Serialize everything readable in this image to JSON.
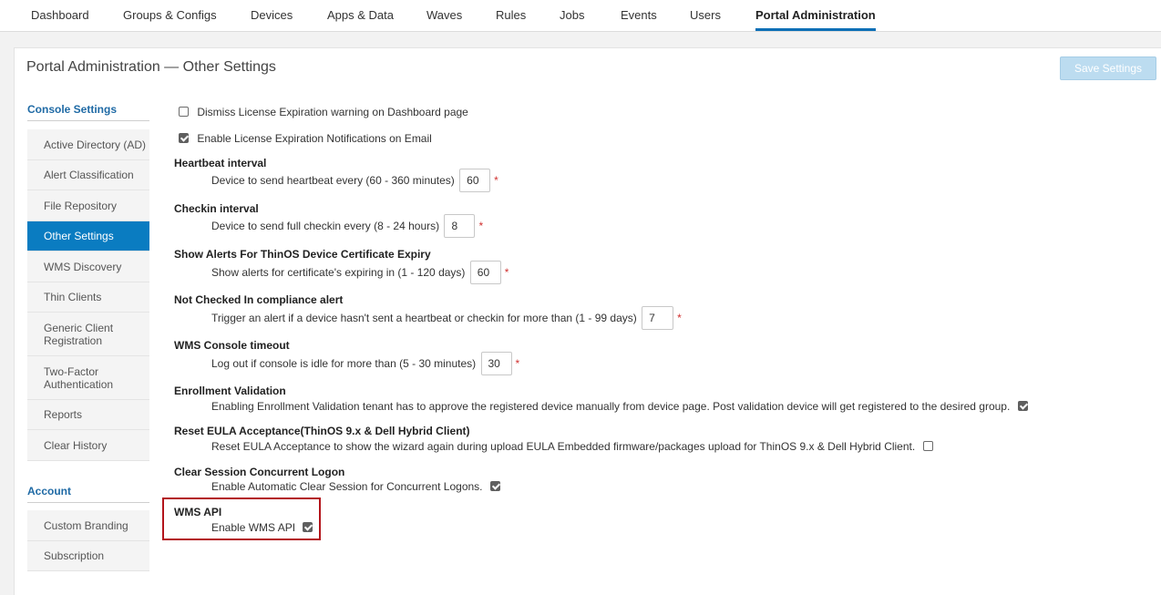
{
  "nav": {
    "items": [
      "Dashboard",
      "Groups & Configs",
      "Devices",
      "Apps & Data",
      "Waves",
      "Rules",
      "Jobs",
      "Events",
      "Users",
      "Portal Administration"
    ],
    "active_index": 9
  },
  "page": {
    "title": "Portal Administration — Other Settings",
    "save_label": "Save Settings"
  },
  "sidebar": {
    "console_heading": "Console Settings",
    "console_items": [
      "Active Directory (AD)",
      "Alert Classification",
      "File Repository",
      "Other Settings",
      "WMS Discovery",
      "Thin Clients",
      "Generic Client Registration",
      "Two-Factor Authentication",
      "Reports",
      "Clear History"
    ],
    "active_item": "Other Settings",
    "account_heading": "Account",
    "account_items": [
      "Custom Branding",
      "Subscription"
    ]
  },
  "settings": {
    "dismiss_license": {
      "label": "Dismiss License Expiration warning on Dashboard page",
      "checked": false
    },
    "enable_license_email": {
      "label": "Enable License Expiration Notifications on Email",
      "checked": true
    },
    "heartbeat": {
      "title": "Heartbeat interval",
      "desc": "Device to send heartbeat every (60 - 360 minutes)",
      "value": "60",
      "required": "*"
    },
    "checkin": {
      "title": "Checkin interval",
      "desc": "Device to send full checkin every (8 - 24 hours)",
      "value": "8",
      "required": "*"
    },
    "cert_expiry": {
      "title": "Show Alerts For ThinOS Device Certificate Expiry",
      "desc": "Show alerts for certificate's expiring in (1 - 120 days)",
      "value": "60",
      "required": "*"
    },
    "not_checked_in": {
      "title": "Not Checked In compliance alert",
      "desc": "Trigger an alert if a device hasn't sent a heartbeat or checkin for more than (1 - 99 days)",
      "value": "7",
      "required": "*"
    },
    "console_timeout": {
      "title": "WMS Console timeout",
      "desc": "Log out if console is idle for more than (5 - 30 minutes)",
      "value": "30",
      "required": "*"
    },
    "enrollment": {
      "title": "Enrollment Validation",
      "desc": "Enabling Enrollment Validation tenant has to approve the registered device manually from device page. Post validation device will get registered to the desired group.",
      "checked": true
    },
    "reset_eula": {
      "title": "Reset EULA Acceptance(ThinOS 9.x & Dell Hybrid Client)",
      "desc": "Reset EULA Acceptance to show the wizard again during upload EULA Embedded firmware/packages upload for ThinOS 9.x & Dell Hybrid Client.",
      "checked": false
    },
    "clear_session": {
      "title": "Clear Session Concurrent Logon",
      "desc": "Enable Automatic Clear Session for Concurrent Logons.",
      "checked": true
    },
    "wms_api": {
      "title": "WMS API",
      "desc": "Enable WMS API",
      "checked": true
    }
  },
  "colors": {
    "accent": "#0a7cc1",
    "highlight_border": "#b3141b",
    "save_disabled": "#bcdcf0"
  }
}
